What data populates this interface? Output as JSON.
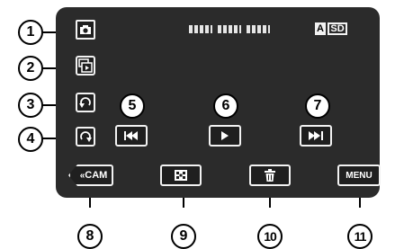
{
  "screen": {
    "media": {
      "a_label": "A",
      "sd_label": "SD"
    }
  },
  "buttons": {
    "cam_label": "CAM",
    "menu_label": "MENU"
  },
  "callouts": {
    "c1": "1",
    "c2": "2",
    "c3": "3",
    "c4": "4",
    "c5": "5",
    "c6": "6",
    "c7": "7",
    "c8": "8",
    "c9": "9",
    "c10": "10",
    "c11": "11"
  },
  "icons": {
    "photo_mode": "camera-icon",
    "playback_mode": "video-playback-icon",
    "rotate_left": "rotate-left-icon",
    "rotate_right": "rotate-right-icon",
    "previous": "skip-previous-icon",
    "play": "play-icon",
    "next": "skip-next-icon",
    "back_to_camera": "back-arrow-icon",
    "index": "grid-icon",
    "delete": "trash-icon"
  }
}
